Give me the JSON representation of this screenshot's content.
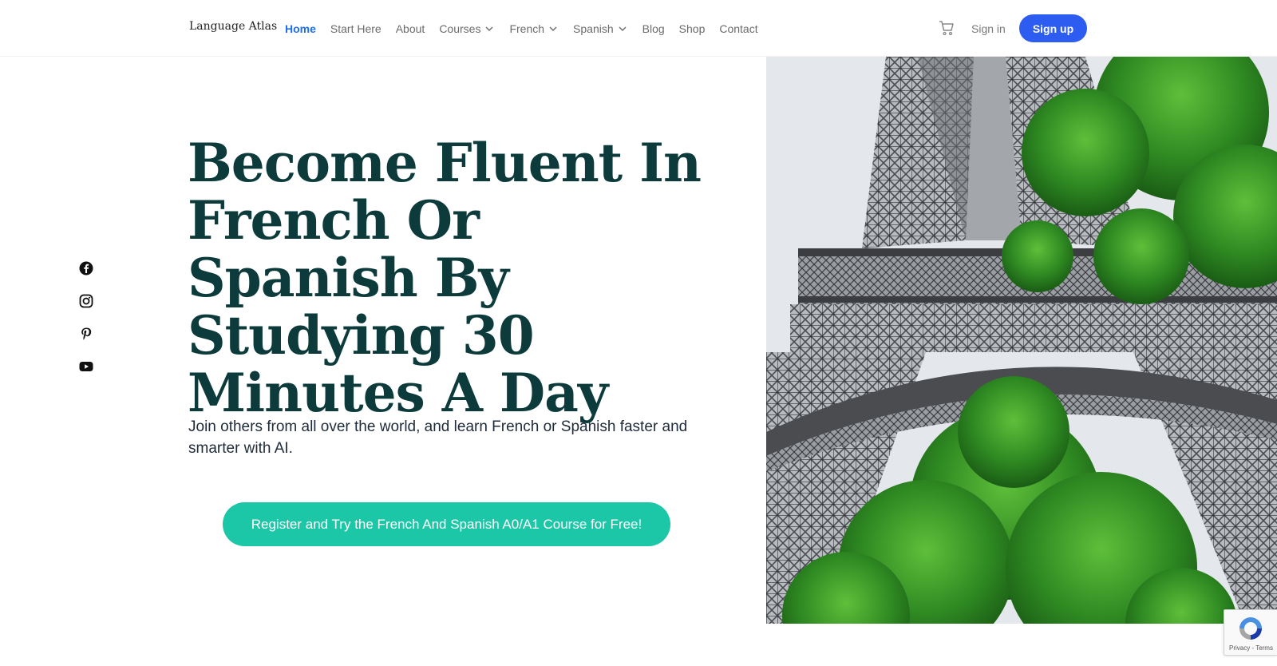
{
  "brand": {
    "logo_text": "Language Atlas"
  },
  "nav": {
    "items": [
      {
        "label": "Home",
        "active": true,
        "dropdown": false
      },
      {
        "label": "Start Here",
        "active": false,
        "dropdown": false
      },
      {
        "label": "About",
        "active": false,
        "dropdown": false
      },
      {
        "label": "Courses",
        "active": false,
        "dropdown": true
      },
      {
        "label": "French",
        "active": false,
        "dropdown": true
      },
      {
        "label": "Spanish",
        "active": false,
        "dropdown": true
      },
      {
        "label": "Blog",
        "active": false,
        "dropdown": false
      },
      {
        "label": "Shop",
        "active": false,
        "dropdown": false
      },
      {
        "label": "Contact",
        "active": false,
        "dropdown": false
      }
    ]
  },
  "header_actions": {
    "signin_label": "Sign in",
    "signup_label": "Sign up",
    "cart_icon": "cart-icon"
  },
  "social": {
    "icons": [
      "facebook-icon",
      "instagram-icon",
      "pinterest-icon",
      "youtube-icon"
    ]
  },
  "hero": {
    "title": "Become Fluent In French Or Spanish By Studying 30 Minutes A Day",
    "subtitle": "Join others from all over the world, and learn French or Spanish faster and smarter with AI.",
    "cta_label": "Register and Try the French And Spanish A0/A1 Course for Free!",
    "image_subject": "eiffel-tower-with-trees"
  },
  "recaptcha": {
    "footer_text": "Privacy - Terms"
  },
  "colors": {
    "accent_blue": "#1e6ef2",
    "signup_bg": "#2c5cf0",
    "cta_bg": "#1cc7a7",
    "title": "#0d3b3b"
  }
}
